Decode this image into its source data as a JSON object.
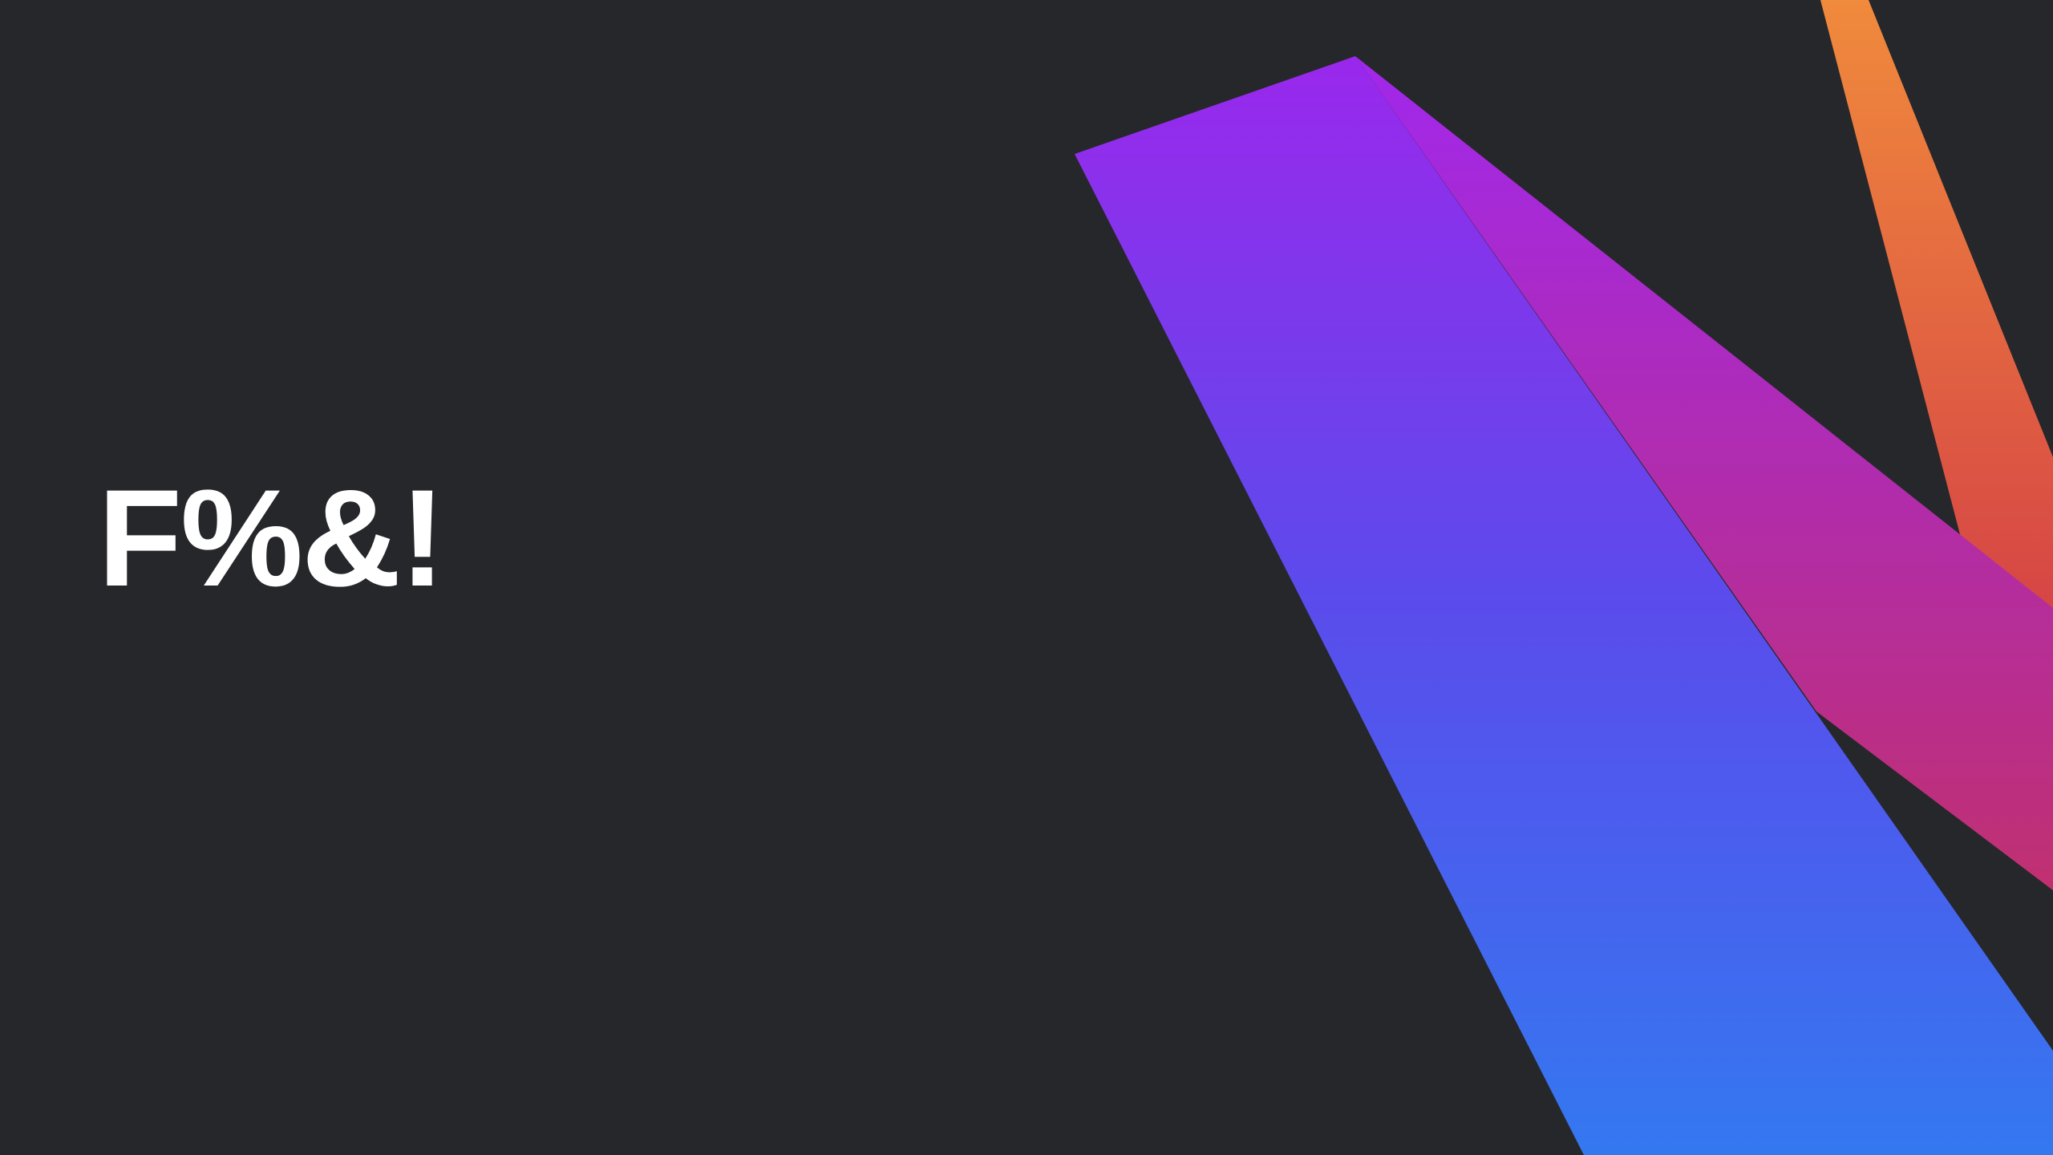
{
  "screen": {
    "headline": "F%&!",
    "background_color": "#26272b",
    "text_color": "#ffffff",
    "decoration": "kotlin-style-gradient-ribbons",
    "accent_colors": {
      "purple": "#a128ec",
      "blue": "#3478f0",
      "magenta": "#c03070",
      "orange": "#f08a3c",
      "red": "#d64545"
    }
  }
}
